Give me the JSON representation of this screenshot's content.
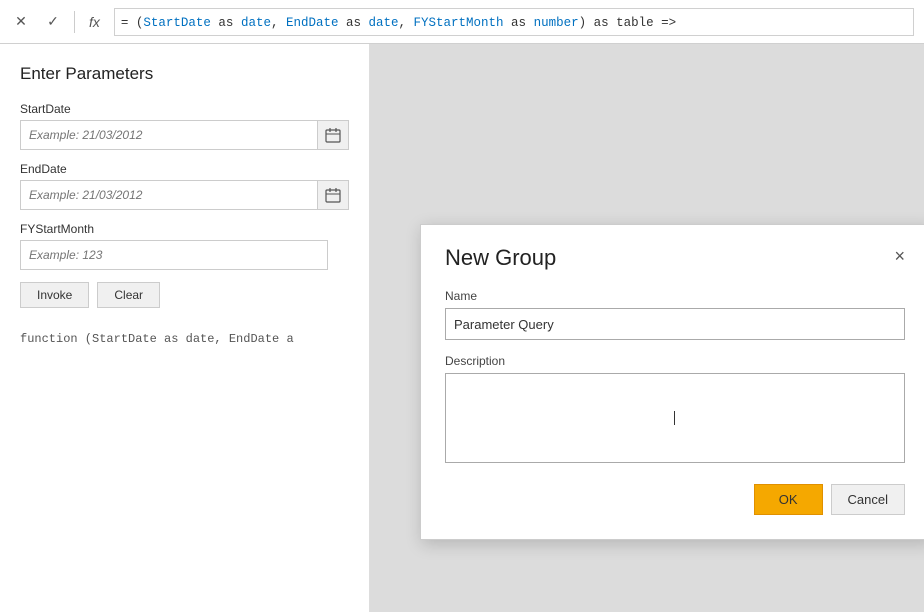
{
  "toolbar": {
    "close_icon": "✕",
    "check_icon": "✓",
    "fx_label": "fx",
    "formula": "= (StartDate as date, EndDate as date, FYStartMonth as number) as table =>"
  },
  "left_panel": {
    "title": "Enter Parameters",
    "fields": [
      {
        "label": "StartDate",
        "placeholder": "Example: 21/03/2012",
        "type": "date"
      },
      {
        "label": "EndDate",
        "placeholder": "Example: 21/03/2012",
        "type": "date"
      },
      {
        "label": "FYStartMonth",
        "placeholder": "Example: 123",
        "type": "text"
      }
    ],
    "invoke_label": "Invoke",
    "clear_label": "Clear",
    "function_text": "function (StartDate as date, EndDate a"
  },
  "dialog": {
    "title": "New Group",
    "close_icon": "×",
    "name_label": "Name",
    "name_value": "Parameter Query",
    "description_label": "Description",
    "description_value": "",
    "ok_label": "OK",
    "cancel_label": "Cancel"
  }
}
